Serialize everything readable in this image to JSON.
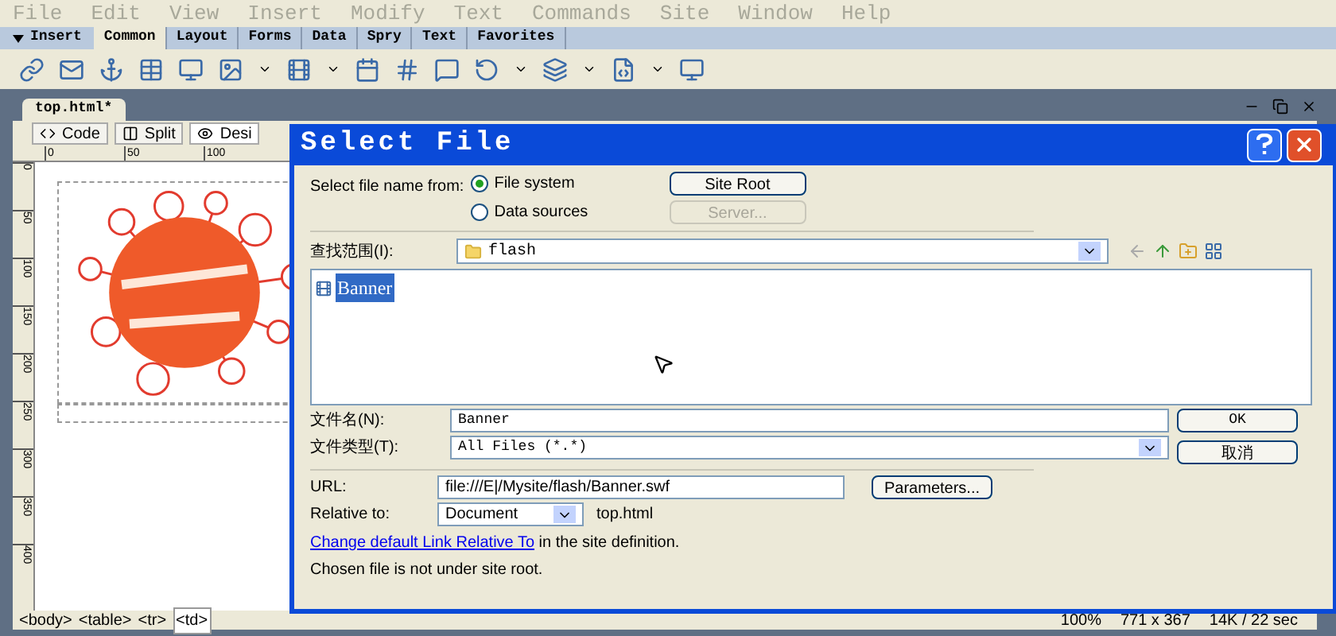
{
  "menu": [
    "File",
    "Edit",
    "View",
    "Insert",
    "Modify",
    "Text",
    "Commands",
    "Site",
    "Window",
    "Help"
  ],
  "insert_bar": {
    "title": "Insert",
    "tabs": [
      {
        "label": "Common",
        "selected": true
      },
      {
        "label": "Layout",
        "selected": false
      },
      {
        "label": "Forms",
        "selected": false
      },
      {
        "label": "Data",
        "selected": false
      },
      {
        "label": "Spry",
        "selected": false
      },
      {
        "label": "Text",
        "selected": false
      },
      {
        "label": "Favorites",
        "selected": false
      }
    ]
  },
  "document": {
    "tab": "top.html*",
    "view_buttons": [
      {
        "label": "Code",
        "selected": false
      },
      {
        "label": "Split",
        "selected": false
      },
      {
        "label": "Desi",
        "selected": true
      }
    ],
    "ruler_h": [
      "0",
      "50",
      "100"
    ],
    "ruler_v": [
      "0",
      "50",
      "100",
      "150",
      "200",
      "250",
      "300",
      "350",
      "400"
    ],
    "tag_selector": [
      {
        "label": "<body>",
        "selected": false
      },
      {
        "label": "<table>",
        "selected": false
      },
      {
        "label": "<tr>",
        "selected": false
      },
      {
        "label": "<td>",
        "selected": true
      }
    ],
    "status": [
      "100%",
      "771 x 367",
      "14K / 22 sec"
    ]
  },
  "dialog": {
    "title": "Select File",
    "select_from_label": "Select file name from:",
    "sources": [
      {
        "label": "File system",
        "selected": true
      },
      {
        "label": "Data sources",
        "selected": false
      }
    ],
    "side_buttons": [
      {
        "label": "Site Root",
        "disabled": false
      },
      {
        "label": "Server...",
        "disabled": true
      }
    ],
    "look_in_label": "查找范围(I):",
    "look_in": "flash",
    "files": [
      {
        "name": "Banner",
        "selected": true
      }
    ],
    "file_name_label": "文件名(N):",
    "file_name": "Banner",
    "file_type_label": "文件类型(T):",
    "file_type": "All Files (*.*)",
    "ok": "OK",
    "cancel": "取消",
    "url_label": "URL:",
    "url": "file:///E|/Mysite/flash/Banner.swf",
    "parameters": "Parameters...",
    "relative_label": "Relative to:",
    "relative": "Document",
    "relative_file": "top.html",
    "link": "Change default Link Relative To",
    "link_rest": " in the site definition.",
    "note": "Chosen file is not under site root."
  }
}
